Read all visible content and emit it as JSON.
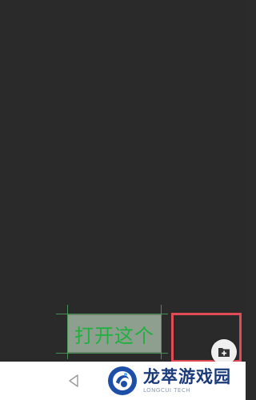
{
  "callout": {
    "text": "打开这个"
  },
  "fab": {
    "icon": "add-folder-icon"
  },
  "navbar": {
    "back_icon": "back-triangle-icon"
  },
  "watermark": {
    "title": "龙萃游戏园",
    "subtitle": "LONGCUI TECH"
  },
  "colors": {
    "screen_bg": "#2a2a2a",
    "highlight": "#e04b55",
    "callout_text": "#20b040",
    "callout_bg": "#8f9f8f"
  }
}
